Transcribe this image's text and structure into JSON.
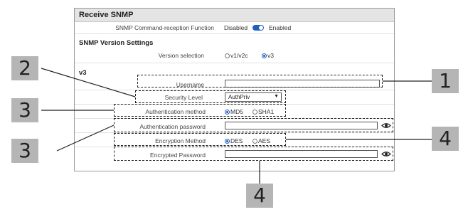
{
  "panel": {
    "title": "Receive SNMP",
    "command_reception": {
      "label": "SNMP Command-reception Function",
      "disabled_label": "Disabled",
      "enabled_label": "Enabled",
      "value": "Enabled"
    },
    "version_section_title": "SNMP Version Settings",
    "version_selection": {
      "label": "Version selection",
      "options": [
        "v1/v2c",
        "v3"
      ],
      "selected": "v3"
    },
    "v3_title": "v3",
    "username": {
      "label": "Username",
      "value": ""
    },
    "security_level": {
      "label": "Security Level",
      "value": "AuthPriv"
    },
    "auth_method": {
      "label": "Authentication method",
      "options": [
        "MD5",
        "SHA1"
      ],
      "selected": "MD5"
    },
    "auth_password": {
      "label": "Authentication password",
      "value": ""
    },
    "encryption_method": {
      "label": "Encryption Method",
      "options": [
        "DES",
        "AES"
      ],
      "selected": "DES"
    },
    "encrypted_password": {
      "label": "Encrypted Password",
      "value": ""
    }
  },
  "callouts": [
    "1",
    "2",
    "3",
    "3",
    "4",
    "4"
  ],
  "icons": {
    "password_toggle": "eye-icon"
  },
  "colors": {
    "accent": "#1f5fbf",
    "header_bg": "#e4e4e4",
    "callout_bg": "#b5b5b5"
  }
}
